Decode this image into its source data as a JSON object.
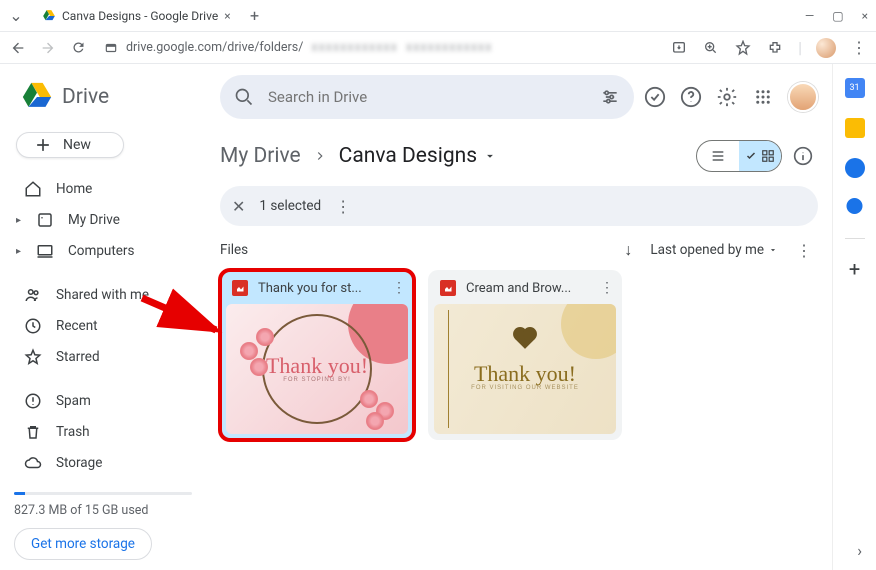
{
  "browser": {
    "tab_title": "Canva Designs - Google Drive",
    "url_visible": "drive.google.com/drive/folders/"
  },
  "app": {
    "logo_text": "Drive",
    "new_button": "New",
    "nav": {
      "home": "Home",
      "my_drive": "My Drive",
      "computers": "Computers",
      "shared": "Shared with me",
      "recent": "Recent",
      "starred": "Starred",
      "spam": "Spam",
      "trash": "Trash",
      "storage": "Storage"
    },
    "storage_used": "827.3 MB of 15 GB used",
    "get_more": "Get more storage"
  },
  "search": {
    "placeholder": "Search in Drive"
  },
  "breadcrumb": {
    "root": "My Drive",
    "current": "Canva Designs"
  },
  "selection_bar": {
    "count": "1 selected"
  },
  "files": {
    "section_label": "Files",
    "sort_label": "Last opened by me",
    "items": [
      {
        "name": "Thank you for st...",
        "thumb_main": "Thank you!",
        "thumb_sub": "FOR STOPING BY!"
      },
      {
        "name": "Cream and Brow...",
        "thumb_main": "Thank you!",
        "thumb_sub": "FOR VISITING OUR WEBSITE"
      }
    ]
  }
}
